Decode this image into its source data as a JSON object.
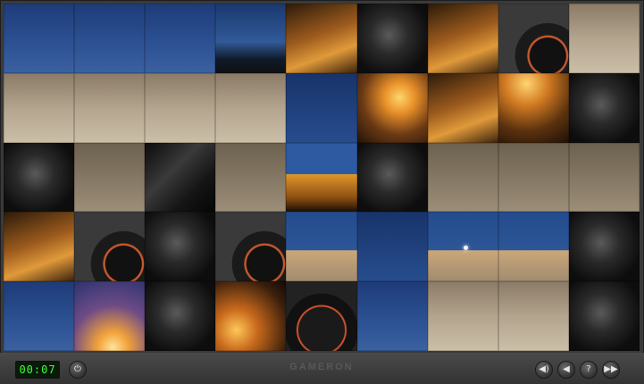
{
  "game": {
    "timer": "00:07",
    "brand": "GAMERON"
  },
  "controls": {
    "power_icon": "power-icon",
    "sound_icon": "speaker-icon",
    "volume_icon": "speaker-low-icon",
    "help_label": "?",
    "skip_icon": "fast-forward-icon"
  },
  "puzzle": {
    "rows": 5,
    "cols": 9,
    "tiles": [
      "sky",
      "sky",
      "sky",
      "dusk",
      "orange",
      "bike",
      "orange",
      "wheel",
      "sand",
      "sand",
      "sand",
      "sand",
      "sand",
      "sky2",
      "glow",
      "orange",
      "tree",
      "bike",
      "bike",
      "sand2",
      "bike2",
      "sand2",
      "house",
      "bike",
      "sand2",
      "sand2",
      "sand2",
      "orange",
      "wheel",
      "bike",
      "wheel",
      "night",
      "sky2",
      "night",
      "night",
      "bike",
      "sky",
      "glowSky",
      "bike",
      "glow2",
      "bikeRed",
      "sky",
      "sand",
      "sand",
      "bike"
    ]
  }
}
